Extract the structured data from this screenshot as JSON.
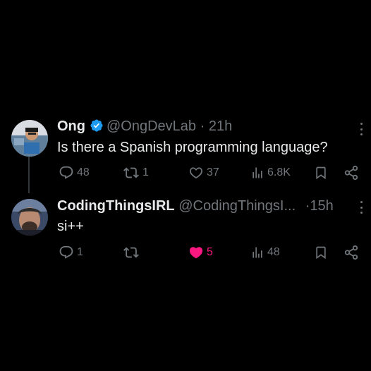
{
  "tweets": [
    {
      "name": "Ong",
      "handle": "@OngDevLab",
      "separator": "·",
      "time": "21h",
      "text": "Is there a Spanish programming language?",
      "replies": "48",
      "retweets": "1",
      "likes": "37",
      "views": "6.8K",
      "verified": true,
      "liked": false
    },
    {
      "name": "CodingThingsIRL",
      "handle": "@CodingThingsI...",
      "separator": "·",
      "time": "15h",
      "text": "si++",
      "replies": "1",
      "retweets": "",
      "likes": "5",
      "views": "48",
      "verified": false,
      "liked": true
    }
  ],
  "colors": {
    "background": "#000000",
    "primary_text": "#e7e9ea",
    "secondary_text": "#71767b",
    "verified": "#1d9bf0",
    "like_active": "#f91880"
  },
  "icons": [
    "reply-icon",
    "retweet-icon",
    "like-icon",
    "views-icon",
    "bookmark-icon",
    "share-icon",
    "more-icon",
    "verified-badge-icon"
  ]
}
